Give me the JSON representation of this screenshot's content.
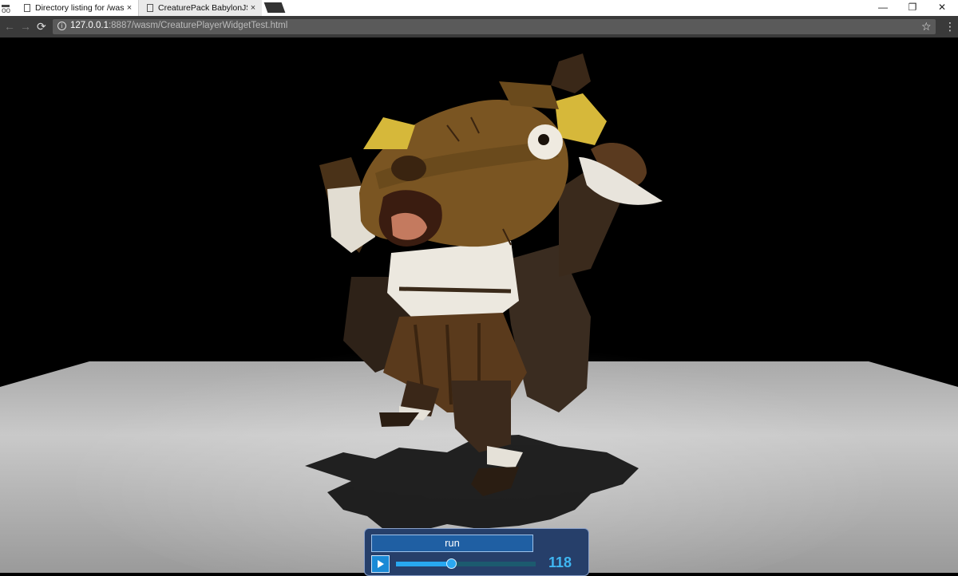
{
  "browser": {
    "tabs": [
      {
        "title": "Directory listing for /wasm"
      },
      {
        "title": "CreaturePack BabylonJS WebGL"
      }
    ],
    "tab_close_glyph": "×",
    "menu_icon": "incognito-icon",
    "window_controls": {
      "minimize": "—",
      "restore": "❐",
      "close": "✕"
    },
    "nav": {
      "back": "←",
      "forward": "→",
      "reload": "⟳"
    },
    "address": {
      "host": "127.0.0.1",
      "rest": ":8887/wasm/CreaturePlayerWidgetTest.html"
    },
    "info_glyph": "i",
    "bookmark_glyph": "☆",
    "menu_glyph": "⋮"
  },
  "scene": {
    "background_color": "#000000",
    "floor_color": "#b8b8b8",
    "character": "horse-head-creature"
  },
  "player": {
    "animation_label": "run",
    "progress": 0.4,
    "frame": "118",
    "colors": {
      "panel": "#263f6a",
      "button": "#1f5fa3",
      "accent": "#28a8f0",
      "frame_text": "#3fb6f2"
    }
  }
}
